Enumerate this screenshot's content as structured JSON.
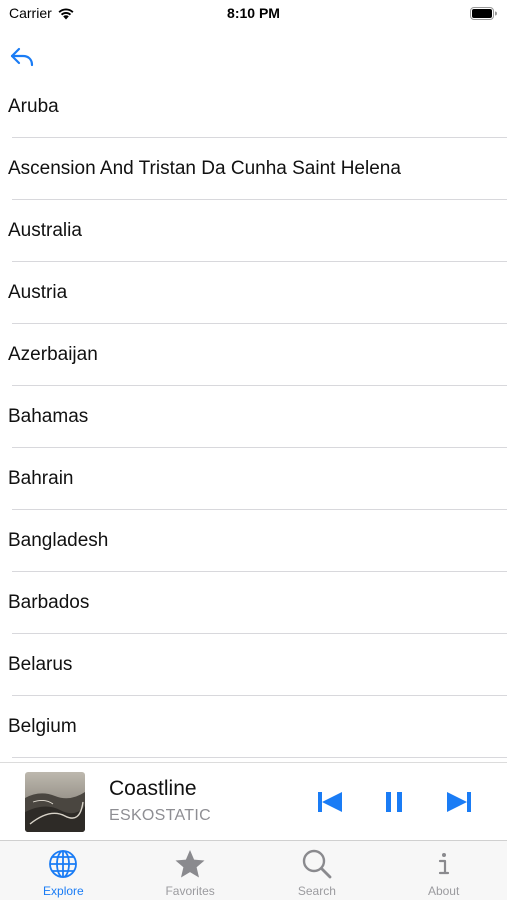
{
  "status_bar": {
    "carrier": "Carrier",
    "time": "8:10 PM"
  },
  "nav": {
    "back_icon": "back-arrow-icon"
  },
  "countries": [
    "Aruba",
    "Ascension And Tristan Da Cunha Saint Helena",
    "Australia",
    "Austria",
    "Azerbaijan",
    "Bahamas",
    "Bahrain",
    "Bangladesh",
    "Barbados",
    "Belarus",
    "Belgium"
  ],
  "player": {
    "title": "Coastline",
    "artist": "ESKOSTATIC",
    "state": "playing"
  },
  "tabs": [
    {
      "label": "Explore",
      "icon": "globe-icon",
      "active": true
    },
    {
      "label": "Favorites",
      "icon": "star-icon",
      "active": false
    },
    {
      "label": "Search",
      "icon": "search-icon",
      "active": false
    },
    {
      "label": "About",
      "icon": "info-icon",
      "active": false
    }
  ],
  "colors": {
    "accent": "#1a7cf5",
    "inactive": "#9b9b9f",
    "separator": "#d8d8dc"
  }
}
